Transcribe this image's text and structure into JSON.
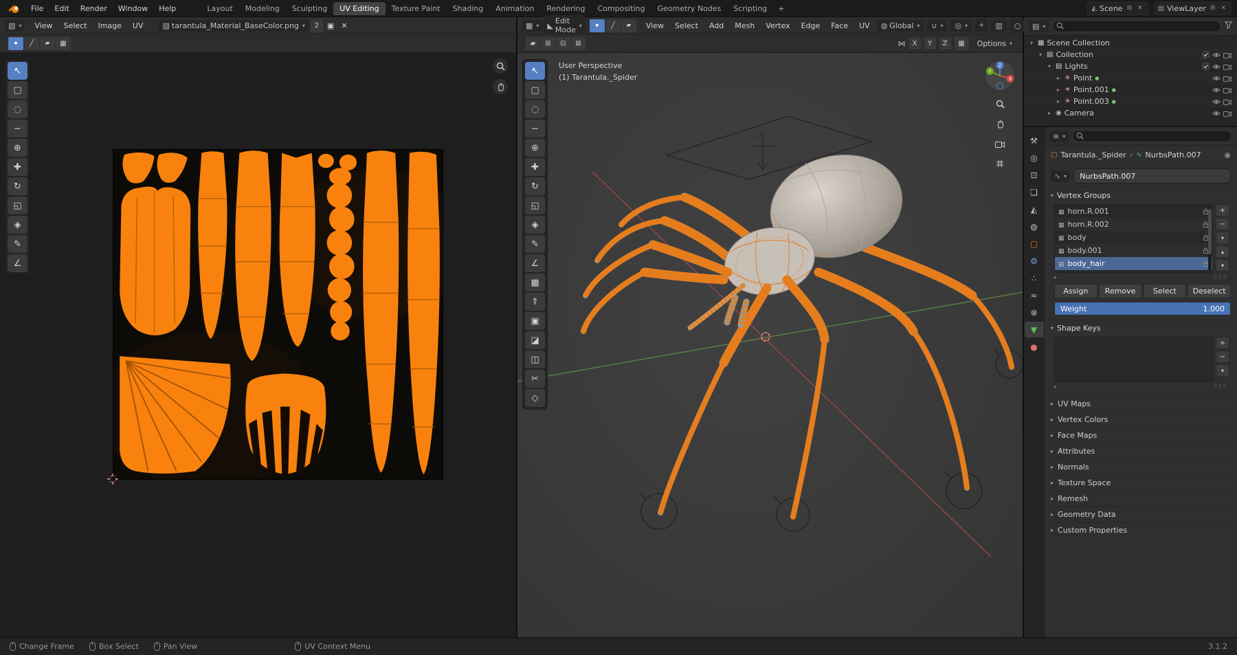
{
  "topbar": {
    "menus": [
      "File",
      "Edit",
      "Render",
      "Window",
      "Help"
    ],
    "workspaces": [
      {
        "label": "Layout"
      },
      {
        "label": "Modeling"
      },
      {
        "label": "Sculpting"
      },
      {
        "label": "UV Editing",
        "active": true
      },
      {
        "label": "Texture Paint"
      },
      {
        "label": "Shading"
      },
      {
        "label": "Animation"
      },
      {
        "label": "Rendering"
      },
      {
        "label": "Compositing"
      },
      {
        "label": "Geometry Nodes"
      },
      {
        "label": "Scripting"
      }
    ],
    "add_workspace_label": "+",
    "scene_selector": {
      "label": "Scene"
    },
    "viewlayer_selector": {
      "label": "ViewLayer"
    }
  },
  "uv_editor": {
    "header_menus": [
      "View",
      "Select",
      "Image",
      "UV"
    ],
    "image_name": "tarantula_Material_BaseColor.png",
    "image_users": "2",
    "tools": [
      {
        "name": "select",
        "glyph": "↖",
        "active": true
      },
      {
        "name": "select-box",
        "glyph": "▢"
      },
      {
        "name": "select-circle",
        "glyph": "◌"
      },
      {
        "name": "select-lasso",
        "glyph": "∽"
      },
      {
        "name": "cursor",
        "glyph": "⊕"
      },
      {
        "name": "move",
        "glyph": "✚"
      },
      {
        "name": "rotate",
        "glyph": "↻"
      },
      {
        "name": "scale",
        "glyph": "◱"
      },
      {
        "name": "transform",
        "glyph": "◈"
      },
      {
        "name": "annotate",
        "glyph": "✎"
      },
      {
        "name": "measure",
        "glyph": "∠"
      }
    ]
  },
  "viewport": {
    "mode_label": "Edit Mode",
    "header_menus": [
      "View",
      "Select",
      "Add",
      "Mesh",
      "Vertex",
      "Edge",
      "Face",
      "UV"
    ],
    "orientation_label": "Global",
    "options_label": "Options",
    "overlay_line1": "User Perspective",
    "overlay_line2": "(1) Tarantula._Spider",
    "mirror_axes": [
      "X",
      "Y",
      "Z"
    ],
    "gizmo": {
      "x_label": "X",
      "y_label": "Y",
      "z_label": "Z"
    },
    "tools": [
      {
        "name": "select",
        "glyph": "↖",
        "active": true
      },
      {
        "name": "select-box",
        "glyph": "▢"
      },
      {
        "name": "select-circle",
        "glyph": "◌"
      },
      {
        "name": "select-lasso",
        "glyph": "∽"
      },
      {
        "name": "cursor",
        "glyph": "⊕"
      },
      {
        "name": "move",
        "glyph": "✚"
      },
      {
        "name": "rotate",
        "glyph": "↻"
      },
      {
        "name": "scale",
        "glyph": "◱"
      },
      {
        "name": "transform",
        "glyph": "◈"
      },
      {
        "name": "annotate",
        "glyph": "✎"
      },
      {
        "name": "measure",
        "glyph": "∠"
      },
      {
        "name": "add-cube",
        "glyph": "▦"
      },
      {
        "name": "extrude",
        "glyph": "⇑"
      },
      {
        "name": "inset",
        "glyph": "▣"
      },
      {
        "name": "bevel",
        "glyph": "◪"
      },
      {
        "name": "loop-cut",
        "glyph": "◫"
      },
      {
        "name": "knife",
        "glyph": "✂"
      },
      {
        "name": "poly-build",
        "glyph": "◇"
      }
    ]
  },
  "outliner": {
    "rows": [
      {
        "label": "Scene Collection",
        "depth": 0,
        "caret": "▾",
        "icon": "▦",
        "icon_color": "#cccccc"
      },
      {
        "label": "Collection",
        "depth": 1,
        "caret": "▾",
        "icon": "▤",
        "icon_color": "#d2d2d2",
        "check": true,
        "eye": true,
        "cam": true
      },
      {
        "label": "Lights",
        "depth": 2,
        "caret": "▾",
        "icon": "▤",
        "icon_color": "#d2d2d2",
        "check": true,
        "eye": true,
        "cam": true
      },
      {
        "label": "Point",
        "depth": 3,
        "caret": "▸",
        "icon": "☀",
        "icon_color": "#e2a49c",
        "badge": "●",
        "eye": true,
        "cam": true
      },
      {
        "label": "Point.001",
        "depth": 3,
        "caret": "▸",
        "icon": "☀",
        "icon_color": "#e2a49c",
        "badge": "●",
        "eye": true,
        "cam": true
      },
      {
        "label": "Point.003",
        "depth": 3,
        "caret": "▸",
        "icon": "☀",
        "icon_color": "#e2a49c",
        "badge": "●",
        "eye": true,
        "cam": true
      },
      {
        "label": "Camera",
        "depth": 2,
        "caret": "▸",
        "icon": "◉",
        "icon_color": "#a9b8a9",
        "eye": true,
        "cam": true
      }
    ]
  },
  "properties": {
    "tabs": [
      {
        "name": "tool",
        "glyph": "⚒",
        "color": "#c0c0c0"
      },
      {
        "name": "render",
        "glyph": "◎",
        "color": "#c0c0c0"
      },
      {
        "name": "output",
        "glyph": "⊡",
        "color": "#c0c0c0"
      },
      {
        "name": "view-layer",
        "glyph": "❏",
        "color": "#c0c0c0"
      },
      {
        "name": "scene",
        "glyph": "◭",
        "color": "#c0c0c0"
      },
      {
        "name": "world",
        "glyph": "◍",
        "color": "#c0c0c0"
      },
      {
        "name": "object",
        "glyph": "▢",
        "color": "#e0812a"
      },
      {
        "name": "modifiers",
        "glyph": "⚙",
        "color": "#77a7e0"
      },
      {
        "name": "particles",
        "glyph": "∴",
        "color": "#c0c0c0"
      },
      {
        "name": "physics",
        "glyph": "≈",
        "color": "#8fc3e8"
      },
      {
        "name": "constraints",
        "glyph": "⊗",
        "color": "#c0c0c0"
      },
      {
        "name": "data",
        "glyph": "▼",
        "color": "#58c05a",
        "active": true
      },
      {
        "name": "material",
        "glyph": "●",
        "color": "#d77070"
      }
    ],
    "breadcrumb": {
      "object": "Tarantula._Spider",
      "data": "NurbsPath.007"
    },
    "name_value": "NurbsPath.007",
    "vertex_groups": {
      "title": "Vertex Groups",
      "rows": [
        {
          "label": "horn.R.001"
        },
        {
          "label": "horn.R.002"
        },
        {
          "label": "body"
        },
        {
          "label": "body.001"
        },
        {
          "label": "body_hair",
          "selected": true
        }
      ],
      "buttons": [
        "Assign",
        "Remove",
        "Select",
        "Deselect"
      ],
      "weight_label": "Weight",
      "weight_value": "1.000"
    },
    "shape_keys_title": "Shape Keys",
    "collapsed_panels": [
      "UV Maps",
      "Vertex Colors",
      "Face Maps",
      "Attributes",
      "Normals",
      "Texture Space",
      "Remesh",
      "Geometry Data",
      "Custom Properties"
    ]
  },
  "statusbar": {
    "hints": [
      {
        "label": "Change Frame"
      },
      {
        "label": "Box Select"
      },
      {
        "label": "Pan View"
      },
      {
        "label": "UV Context Menu"
      }
    ],
    "version": "3.1.2"
  }
}
